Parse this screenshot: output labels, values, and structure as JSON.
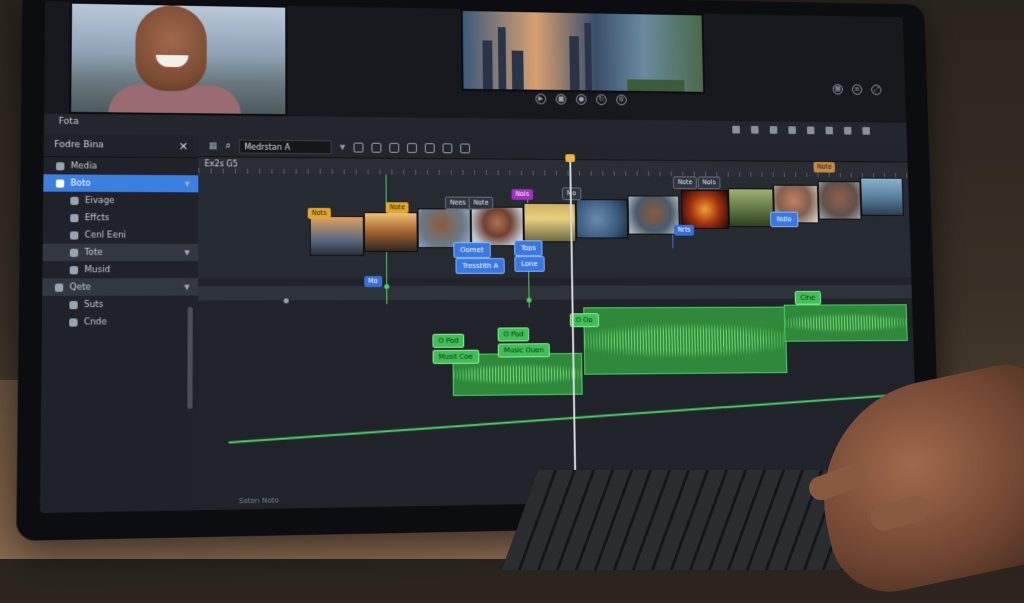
{
  "app": {
    "title": "Fota"
  },
  "preview": {
    "left_controls": [
      "play-icon",
      "stop-icon",
      "record-icon",
      "loop-icon",
      "settings-icon"
    ],
    "right_controls": [
      "grid-icon",
      "layers-icon",
      "fit-icon"
    ]
  },
  "sidebar": {
    "header": "Fodre Bina",
    "items": [
      {
        "label": "Media",
        "icon": "folder-icon",
        "state": "normal"
      },
      {
        "label": "Boto",
        "icon": "photo-icon",
        "state": "active"
      },
      {
        "label": "Eivage",
        "icon": "image-icon",
        "state": "normal"
      },
      {
        "label": "Effcts",
        "icon": "effects-icon",
        "state": "normal"
      },
      {
        "label": "Cenl Eeni",
        "icon": "clip-icon",
        "state": "normal"
      },
      {
        "label": "Tote",
        "icon": "text-icon",
        "state": "grey"
      },
      {
        "label": "Musid",
        "icon": "music-icon",
        "state": "normal"
      },
      {
        "label": "Qete",
        "icon": "transition-icon",
        "state": "grey"
      },
      {
        "label": "Suts",
        "icon": "sound-icon",
        "state": "normal"
      },
      {
        "label": "Cnde",
        "icon": "code-icon",
        "state": "normal"
      }
    ]
  },
  "toolbar": {
    "search_value": "Medrstan A",
    "icons": [
      "scissors-icon",
      "link-icon",
      "trim-icon",
      "split-icon",
      "marker-icon",
      "snap-icon",
      "zoom-icon"
    ]
  },
  "timeline": {
    "timecode": "Ex2s G5",
    "tags": {
      "t1": "Nots",
      "t2": "Note",
      "t3": "Nees",
      "t4": "Note",
      "t5": "Nols",
      "t6": "Mo",
      "t7": "Note",
      "t8": "Nols",
      "t9": "Note",
      "t10": "Nrts",
      "t11": "Mo"
    },
    "title_clips": {
      "c1": "Oomet",
      "c2": "Tresstith A",
      "c3": "Tops",
      "c4": "Lone",
      "c5": "Ndlo"
    },
    "audio_labels": {
      "a1": "O Pod",
      "a2": "Musit Coe",
      "a3": "O Pod",
      "a4": "Music Ouen",
      "a5": "O Oo",
      "a6": "Clne"
    },
    "status": "Soton Noto"
  },
  "colors": {
    "accent": "#3b7fe0",
    "audio": "#2e8a3a",
    "marker": "#e0a82e",
    "playhead": "#d8dadc"
  }
}
